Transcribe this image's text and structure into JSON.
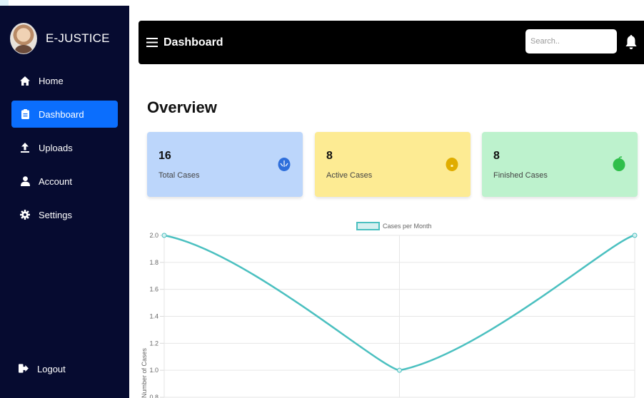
{
  "sidebar": {
    "brand": "E-JUSTICE",
    "items": [
      {
        "label": "Home",
        "icon": "home-icon"
      },
      {
        "label": "Dashboard",
        "icon": "clipboard-icon",
        "active": true
      },
      {
        "label": "Uploads",
        "icon": "upload-icon"
      },
      {
        "label": "Account",
        "icon": "user-icon"
      },
      {
        "label": "Settings",
        "icon": "gear-icon"
      }
    ],
    "logout": "Logout"
  },
  "topbar": {
    "title": "Dashboard",
    "search_placeholder": "Search.."
  },
  "main": {
    "title": "Overview",
    "cards": [
      {
        "value": "16",
        "label": "Total Cases",
        "bg": "#bcd6fb",
        "icon_color": "#2f6fdb"
      },
      {
        "value": "8",
        "label": "Active Cases",
        "bg": "#fdeb93",
        "icon_color": "#e0ad00"
      },
      {
        "value": "8",
        "label": "Finished Cases",
        "bg": "#bdf2cd",
        "icon_color": "#2fbf4a"
      }
    ]
  },
  "colors": {
    "sidebar_bg": "#060b30",
    "active_item": "#0b6efd",
    "line": "#4bc0c0"
  },
  "chart_data": {
    "type": "line",
    "x": [
      "",
      "",
      ""
    ],
    "series": [
      {
        "name": "Cases per Month",
        "values": [
          2,
          1,
          2
        ]
      }
    ],
    "ylabel": "Number of Cases",
    "y_ticks": [
      "2.0",
      "1.8",
      "1.6",
      "1.4",
      "1.2",
      "1.0",
      "0.8"
    ],
    "ylim": [
      0.8,
      2.0
    ],
    "grid": true,
    "legend": "top"
  }
}
